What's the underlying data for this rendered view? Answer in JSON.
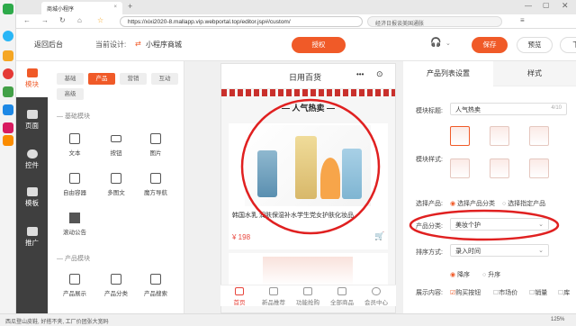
{
  "browser": {
    "tab_title": "商城小程序",
    "url": "https://xixi2020-8.mallapp.vip.webportal.top/editor.jsp#/custom/",
    "search_placeholder": "经济日报谈美国通胀"
  },
  "topbar": {
    "back_label": "返回后台",
    "current_design_label": "当前设计:",
    "current_design_value": "小程序商城",
    "publish_label": "授权",
    "save_label": "保存",
    "preview_label": "预览",
    "more_label": "下"
  },
  "leftnav": [
    {
      "label": "模块",
      "active": true
    },
    {
      "label": "页面"
    },
    {
      "label": "控件"
    },
    {
      "label": "模板"
    },
    {
      "label": "推广"
    }
  ],
  "widget_tabs": [
    "基础",
    "产品",
    "营销",
    "互动",
    "高级"
  ],
  "widgets": {
    "basic_section": "基础模块",
    "basic_items": [
      "文本",
      "按钮",
      "图片",
      "自由容器",
      "多图文",
      "魔方导航",
      "滚动公告"
    ],
    "product_section": "产品模块",
    "product_items": [
      "产品展示",
      "产品分类",
      "产品搜索"
    ]
  },
  "phone": {
    "title": "日用百货",
    "section_title": "人气热卖",
    "product_name": "韩国水乳 润肤保湿补水学生党女护肤化妆品",
    "price": "¥ 198",
    "bottom_tabs": [
      "首页",
      "新品推荐",
      "功能抢购",
      "全部商品",
      "会员中心"
    ]
  },
  "panel": {
    "tabs": [
      "产品列表设置",
      "样式"
    ],
    "module_title_label": "模块标题:",
    "module_title_value": "人气热卖",
    "module_title_count": "4/10",
    "module_style_label": "模块样式:",
    "select_product_label": "选择产品:",
    "select_by_category": "选择产品分类",
    "select_specific": "选择指定产品",
    "category_label": "产品分类:",
    "category_value": "美妆个护",
    "sort_label": "排序方式:",
    "sort_value": "录入时间",
    "asc_label": "降序",
    "desc_label": "升序",
    "display_label": "展示内容:",
    "display_options": [
      "购买按钮",
      "市场价",
      "销量",
      "库"
    ]
  },
  "status": {
    "left_text": "西瓜登山皮鞋, 好搭不夹, 工厂价团张大宽码",
    "zoom": "125%"
  },
  "colors": {
    "accent": "#f05a28",
    "annotation_red": "#e02020",
    "price": "#e8453c"
  }
}
